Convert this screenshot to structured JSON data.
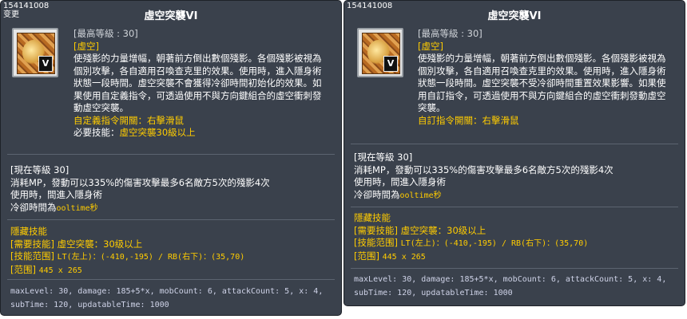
{
  "left": {
    "id": "154141008",
    "changed_label": "变更",
    "title": "虛空突襲VI",
    "icon_badge": "V",
    "max_level": "[最高等級 : 30]",
    "element": "[虛空]",
    "desc_lines": [
      "使殘影的力量增幅，朝著前方倒出數個殘影。各個殘影被視為",
      "個別攻擊，各自適用召喚查克里的效果。使用時，進入隱身術",
      "狀態一段時間。虛空突襲不會獲得冷卻時間初始化的效果。如",
      "果使用自定義指令，可透過使用不與方向鍵組合的虛空衝刺發",
      "動虛空突襲。"
    ],
    "custom_cmd": "自定義指令開關：右擊滑鼠",
    "required_prefix": "必要技能：",
    "required_value": "虛空突襲30級以上",
    "current_level": "[現在等級 30]",
    "level_lines": [
      "消耗MP，發動可以335%的傷害攻擊最多6名敵方5次的殘影4次",
      "使用時，間進入隱身術"
    ],
    "cooldown_prefix": "冷卻時間為",
    "cooldown_value": "ooltime秒",
    "hidden_title": "隱藏技能",
    "hidden_required_label": "[需要技能]",
    "hidden_required_value": "虛空突襲：30级以上",
    "hidden_range_label": "[技能范围]",
    "hidden_range_value": "LT(左上)：(-410,-195) / RB(右下)：(35,70)",
    "hidden_area_label": "[范围]",
    "hidden_area_value": "445 x 265",
    "meta_lines": [
      "maxLevel: 30, damage: 185+5*x, mobCount: 6, attackCount: 5, x: 4,",
      "subTime: 120, updatableTime: 1000"
    ]
  },
  "right": {
    "id": "154141008",
    "title": "虛空突襲VI",
    "icon_badge": "V",
    "max_level": "[最高等級 : 30]",
    "element": "[虛空]",
    "desc_lines": [
      "使殘影的力量增幅，朝著前方倒出數個殘影。各個殘影被視為",
      "個別攻擊，各自適用召喚查克里的效果。使用時，進入隱身術",
      "狀態一段時間。虛空突襲不受冷卻時間重置效果影響。如果使",
      "用自訂指令，可透過使用不與方向鍵組合的虛空衝刺發動虛空",
      "突襲。"
    ],
    "custom_cmd": "自訂指令開關：右擊滑鼠",
    "current_level": "[現在等級 30]",
    "level_lines": [
      "消耗MP，發動可以335%的傷害攻擊最多6名敵方5次的殘影4次",
      "使用時，間進入隱身術"
    ],
    "cooldown_prefix": "冷卻時間為",
    "cooldown_value": "ooltime秒",
    "hidden_title": "隱藏技能",
    "hidden_required_label": "[需要技能]",
    "hidden_required_value": "虛空突襲：30级以上",
    "hidden_range_label": "[技能范围]",
    "hidden_range_value": "LT(左上)：(-410,-195) / RB(右下)：(35,70)",
    "hidden_area_label": "[范围]",
    "hidden_area_value": "445 x 265",
    "meta_lines": [
      "maxLevel: 30, damage: 185+5*x, mobCount: 6, attackCount: 5, x: 4,",
      "subTime: 120, updatableTime: 1000"
    ]
  }
}
